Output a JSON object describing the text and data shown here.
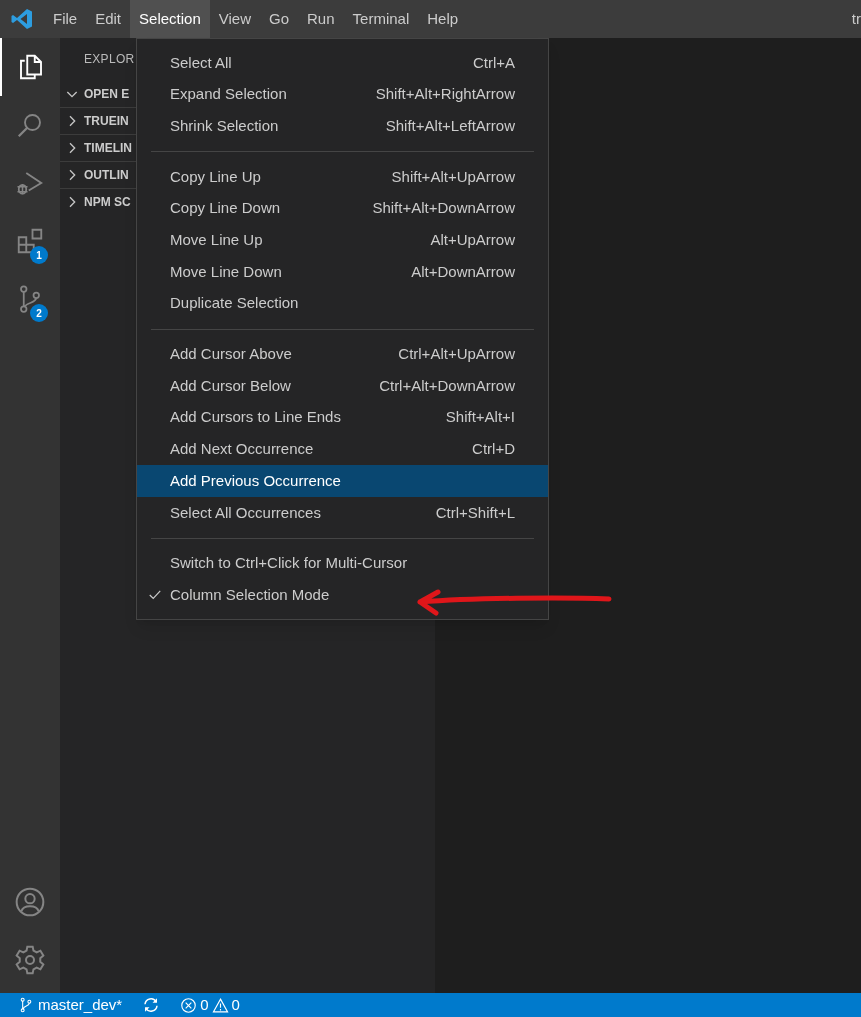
{
  "menubar": {
    "items": [
      {
        "label": "File",
        "selected": false
      },
      {
        "label": "Edit",
        "selected": false
      },
      {
        "label": "Selection",
        "selected": true
      },
      {
        "label": "View",
        "selected": false
      },
      {
        "label": "Go",
        "selected": false
      },
      {
        "label": "Run",
        "selected": false
      },
      {
        "label": "Terminal",
        "selected": false
      },
      {
        "label": "Help",
        "selected": false
      }
    ],
    "title": "tr"
  },
  "activity_bar": {
    "items": [
      {
        "kind": "files",
        "selected": true
      },
      {
        "kind": "search",
        "selected": false
      },
      {
        "kind": "debug",
        "selected": false
      },
      {
        "kind": "extensions",
        "selected": false,
        "badge": "1"
      },
      {
        "kind": "source-control",
        "selected": false,
        "badge": "2"
      }
    ],
    "bottom": [
      {
        "kind": "account"
      },
      {
        "kind": "settings"
      }
    ]
  },
  "sidebar": {
    "title": "EXPLOR",
    "sections": [
      {
        "label": "OPEN E",
        "expanded": true
      },
      {
        "label": "TRUEIN",
        "expanded": false
      },
      {
        "label": "TIMELIN",
        "expanded": false
      },
      {
        "label": "OUTLIN",
        "expanded": false
      },
      {
        "label": "NPM SC",
        "expanded": false
      }
    ]
  },
  "menu": {
    "items": [
      {
        "kind": "item",
        "label": "Select All",
        "shortcut": "Ctrl+A",
        "selected": false,
        "checked": false
      },
      {
        "kind": "item",
        "label": "Expand Selection",
        "shortcut": "Shift+Alt+RightArrow",
        "selected": false,
        "checked": false
      },
      {
        "kind": "item",
        "label": "Shrink Selection",
        "shortcut": "Shift+Alt+LeftArrow",
        "selected": false,
        "checked": false
      },
      {
        "kind": "separator"
      },
      {
        "kind": "item",
        "label": "Copy Line Up",
        "shortcut": "Shift+Alt+UpArrow",
        "selected": false,
        "checked": false
      },
      {
        "kind": "item",
        "label": "Copy Line Down",
        "shortcut": "Shift+Alt+DownArrow",
        "selected": false,
        "checked": false
      },
      {
        "kind": "item",
        "label": "Move Line Up",
        "shortcut": "Alt+UpArrow",
        "selected": false,
        "checked": false
      },
      {
        "kind": "item",
        "label": "Move Line Down",
        "shortcut": "Alt+DownArrow",
        "selected": false,
        "checked": false
      },
      {
        "kind": "item",
        "label": "Duplicate Selection",
        "selected": false,
        "checked": false
      },
      {
        "kind": "separator"
      },
      {
        "kind": "item",
        "label": "Add Cursor Above",
        "shortcut": "Ctrl+Alt+UpArrow",
        "selected": false,
        "checked": false
      },
      {
        "kind": "item",
        "label": "Add Cursor Below",
        "shortcut": "Ctrl+Alt+DownArrow",
        "selected": false,
        "checked": false
      },
      {
        "kind": "item",
        "label": "Add Cursors to Line Ends",
        "shortcut": "Shift+Alt+I",
        "selected": false,
        "checked": false
      },
      {
        "kind": "item",
        "label": "Add Next Occurrence",
        "shortcut": "Ctrl+D",
        "selected": false,
        "checked": false
      },
      {
        "kind": "item",
        "label": "Add Previous Occurrence",
        "selected": true,
        "checked": false
      },
      {
        "kind": "item",
        "label": "Select All Occurrences",
        "shortcut": "Ctrl+Shift+L",
        "selected": false,
        "checked": false
      },
      {
        "kind": "separator"
      },
      {
        "kind": "item",
        "label": "Switch to Ctrl+Click for Multi-Cursor",
        "selected": false,
        "checked": false
      },
      {
        "kind": "item",
        "label": "Column Selection Mode",
        "selected": false,
        "checked": true
      }
    ]
  },
  "status_bar": {
    "branch": "master_dev*",
    "errors": "0",
    "warnings": "0"
  }
}
